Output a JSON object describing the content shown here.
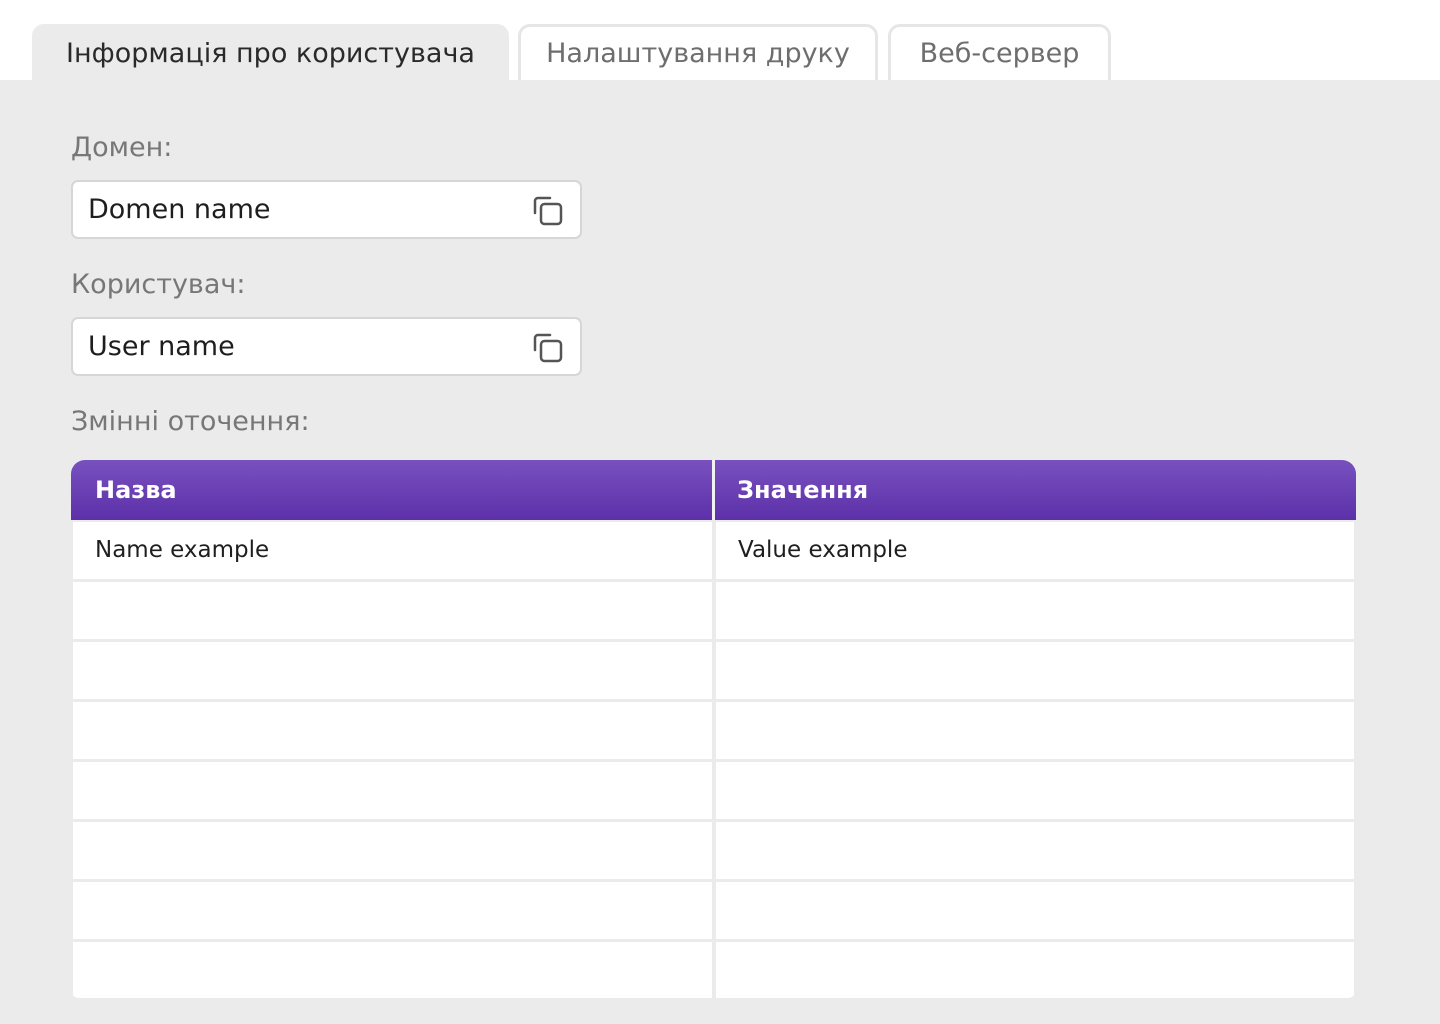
{
  "tabs": [
    {
      "label": "Інформація про користувача",
      "active": true
    },
    {
      "label": "Налаштування друку",
      "active": false
    },
    {
      "label": "Веб-сервер",
      "active": false
    }
  ],
  "domain": {
    "label": "Домен:",
    "value": "Domen name",
    "copy_icon": "copy-icon"
  },
  "user": {
    "label": "Користувач:",
    "value": "User name",
    "copy_icon": "copy-icon"
  },
  "env": {
    "label": "Змінні оточення:",
    "columns": [
      "Назва",
      "Значення"
    ],
    "rows": [
      [
        "Name example",
        "Value example"
      ],
      [
        "",
        ""
      ],
      [
        "",
        ""
      ],
      [
        "",
        ""
      ],
      [
        "",
        ""
      ],
      [
        "",
        ""
      ],
      [
        "",
        ""
      ],
      [
        "",
        ""
      ]
    ]
  },
  "colors": {
    "header_gradient_top": "#7851bf",
    "header_gradient_bottom": "#5d30a9",
    "panel_background": "#ebebeb"
  }
}
